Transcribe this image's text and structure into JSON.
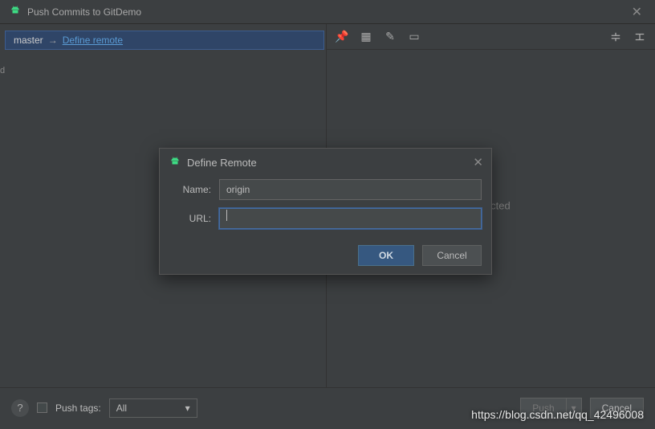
{
  "window": {
    "title": "Push Commits to GitDemo"
  },
  "branch": {
    "local": "master",
    "arrow": "→",
    "remote_link": "Define remote"
  },
  "right": {
    "empty_text": "selected"
  },
  "footer": {
    "push_tags_label": "Push tags:",
    "push_tags_value": "All",
    "push_btn": "Push",
    "cancel_btn": "Cancel"
  },
  "dialog": {
    "title": "Define Remote",
    "name_label": "Name:",
    "name_value": "origin",
    "url_label": "URL:",
    "url_value": "",
    "ok": "OK",
    "cancel": "Cancel"
  },
  "watermark": "https://blog.csdn.net/qq_42496008",
  "side_text": "d"
}
